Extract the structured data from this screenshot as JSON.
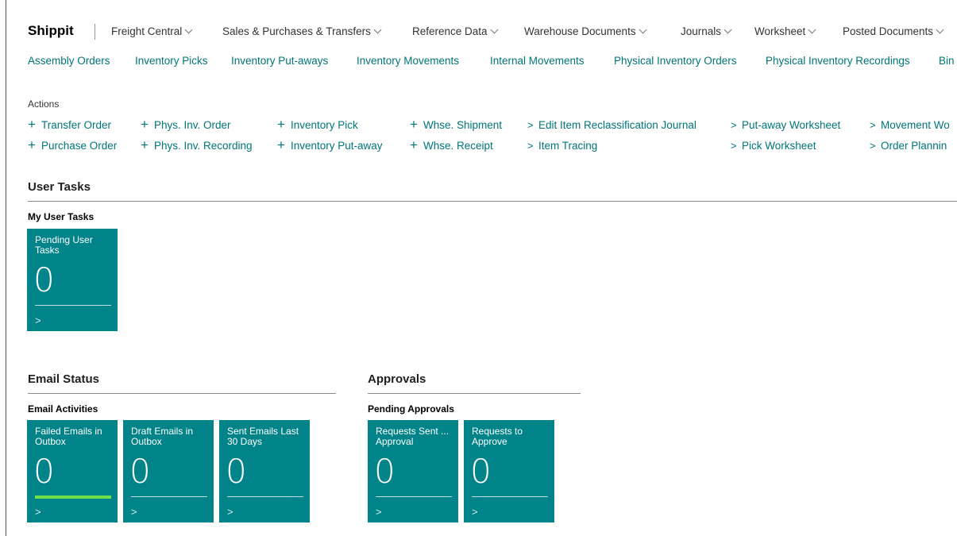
{
  "brand": "Shippit",
  "menu": [
    {
      "label": "Freight Central"
    },
    {
      "label": "Sales & Purchases & Transfers"
    },
    {
      "label": "Reference Data"
    },
    {
      "label": "Warehouse Documents"
    },
    {
      "label": "Journals"
    },
    {
      "label": "Worksheet"
    },
    {
      "label": "Posted Documents"
    }
  ],
  "submenu": [
    "Assembly Orders",
    "Inventory Picks",
    "Inventory Put-aways",
    "Inventory Movements",
    "Internal Movements",
    "Physical Inventory Orders",
    "Physical Inventory Recordings",
    "Bin"
  ],
  "actions": {
    "label": "Actions",
    "items": [
      {
        "symbol": "+",
        "label": "Transfer Order"
      },
      {
        "symbol": "+",
        "label": "Purchase Order"
      },
      {
        "symbol": "+",
        "label": "Phys. Inv. Order"
      },
      {
        "symbol": "+",
        "label": "Phys. Inv. Recording"
      },
      {
        "symbol": "+",
        "label": "Inventory Pick"
      },
      {
        "symbol": "+",
        "label": "Inventory Put-away"
      },
      {
        "symbol": "+",
        "label": "Whse. Shipment"
      },
      {
        "symbol": "+",
        "label": "Whse. Receipt"
      },
      {
        "symbol": ">",
        "label": "Edit Item Reclassification Journal"
      },
      {
        "symbol": ">",
        "label": "Item Tracing"
      },
      {
        "symbol": ">",
        "label": "Put-away Worksheet"
      },
      {
        "symbol": ">",
        "label": "Pick Worksheet"
      },
      {
        "symbol": ">",
        "label": "Movement Wo"
      },
      {
        "symbol": ">",
        "label": "Order Plannin"
      }
    ]
  },
  "user_tasks": {
    "title": "User Tasks",
    "group": "My User Tasks",
    "tiles": [
      {
        "label": "Pending User Tasks",
        "value": "0",
        "arrow": ">"
      }
    ]
  },
  "email_status": {
    "title": "Email Status",
    "group": "Email Activities",
    "tiles": [
      {
        "label": "Failed Emails in Outbox",
        "value": "0",
        "arrow": ">"
      },
      {
        "label": "Draft Emails in Outbox",
        "value": "0",
        "arrow": ">"
      },
      {
        "label": "Sent Emails Last 30 Days",
        "value": "0",
        "arrow": ">"
      }
    ]
  },
  "approvals": {
    "title": "Approvals",
    "group": "Pending Approvals",
    "tiles": [
      {
        "label": "Requests Sent ... Approval",
        "value": "0",
        "arrow": ">"
      },
      {
        "label": "Requests to Approve",
        "value": "0",
        "arrow": ">"
      }
    ]
  },
  "colors": {
    "accent": "#00757a",
    "tile": "#008489",
    "warning_bar": "#6fe04b"
  }
}
